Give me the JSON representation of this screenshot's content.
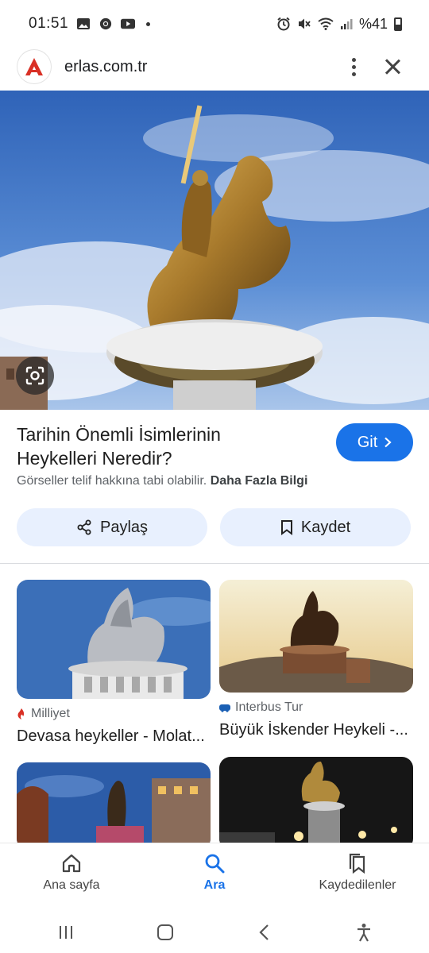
{
  "status_bar": {
    "time": "01:51",
    "battery": "%41",
    "left_icons": [
      "gallery-icon",
      "chrome-icon",
      "youtube-icon"
    ],
    "right_icons": [
      "alarm-icon",
      "mute-icon",
      "wifi-icon",
      "signal-icon",
      "battery-icon"
    ]
  },
  "browser": {
    "url": "erlas.com.tr",
    "logo_letter": "A",
    "brand_color": "#d93025"
  },
  "result": {
    "title": "Tarihin Önemli İsimlerinin Heykelleri Neredir?",
    "visit_label": "Git",
    "copyright_text": "Görseller telif hakkına tabi olabilir.",
    "more_info_link": "Daha Fazla Bilgi",
    "share_label": "Paylaş",
    "save_label": "Kaydet"
  },
  "related": [
    {
      "source": "Milliyet",
      "title": "Devasa heykeller - Molat..."
    },
    {
      "source": "Interbus Tur",
      "title": "Büyük İskender Heykeli -..."
    }
  ],
  "bottom_nav": [
    {
      "label": "Ana sayfa",
      "icon": "home-icon"
    },
    {
      "label": "Ara",
      "icon": "search-icon",
      "active": true
    },
    {
      "label": "Kaydedilenler",
      "icon": "bookmarks-icon"
    }
  ],
  "colors": {
    "accent": "#1a73e8",
    "chip_bg": "#e8f0fe"
  }
}
